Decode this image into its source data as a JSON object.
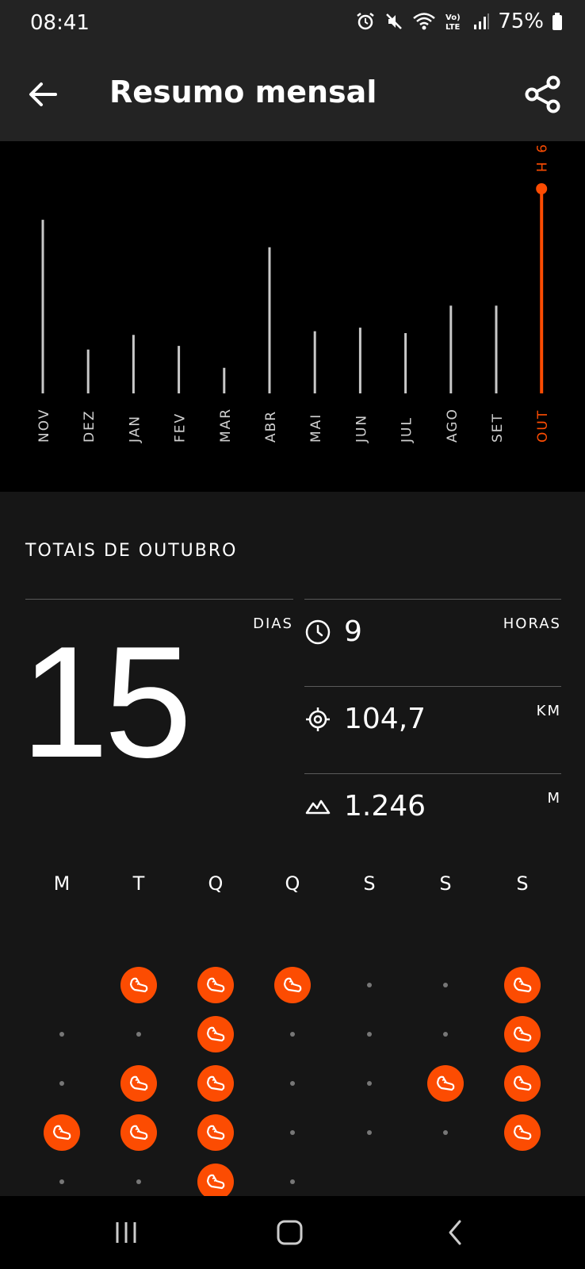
{
  "status": {
    "time": "08:41",
    "battery": "75%",
    "icons": [
      "alarm-icon",
      "mute-icon",
      "wifi-icon",
      "volte-icon",
      "signal-icon",
      "battery-icon"
    ]
  },
  "header": {
    "title": "Resumo mensal",
    "back_icon": "arrow-left-icon",
    "share_icon": "share-icon"
  },
  "chart_data": {
    "type": "bar",
    "categories": [
      "NOV",
      "DEZ",
      "JAN",
      "FEV",
      "MAR",
      "ABR",
      "MAI",
      "JUN",
      "JUL",
      "AGO",
      "SET",
      "OUT"
    ],
    "values": [
      9.5,
      2.4,
      3.2,
      2.6,
      1.4,
      8.0,
      3.4,
      3.6,
      3.3,
      4.8,
      4.8,
      11.2
    ],
    "highlight_index": 11,
    "highlight_label": "9 H",
    "colors": {
      "bar": "#c8c8c8",
      "highlight": "#fc4c02",
      "label": "#d0d0d0"
    }
  },
  "totals": {
    "title": "TOTAIS DE OUTUBRO",
    "days": {
      "value": "15",
      "unit": "DIAS"
    },
    "stats": [
      {
        "icon": "clock-icon",
        "value": "9",
        "unit": "HORAS"
      },
      {
        "icon": "target-icon",
        "value": "104,7",
        "unit": "KM"
      },
      {
        "icon": "mountain-icon",
        "value": "1.246",
        "unit": "M"
      }
    ]
  },
  "calendar": {
    "weekdays": [
      "M",
      "T",
      "Q",
      "Q",
      "S",
      "S",
      "S"
    ],
    "weeks": [
      [
        "empty",
        "run",
        "run",
        "run",
        "dot",
        "dot",
        "run"
      ],
      [
        "dot",
        "dot",
        "run",
        "dot",
        "dot",
        "dot",
        "run"
      ],
      [
        "dot",
        "run",
        "run",
        "dot",
        "dot",
        "run",
        "run"
      ],
      [
        "run",
        "run",
        "run",
        "dot",
        "dot",
        "dot",
        "run"
      ],
      [
        "dot",
        "dot",
        "run",
        "dot",
        "empty",
        "empty",
        "empty"
      ]
    ],
    "run_icon": "running-shoe-icon",
    "accent": "#fc4c02"
  },
  "navigation": {
    "recent_icon": "recent-apps-icon",
    "home_icon": "home-icon",
    "back_icon": "back-chevron-icon"
  }
}
